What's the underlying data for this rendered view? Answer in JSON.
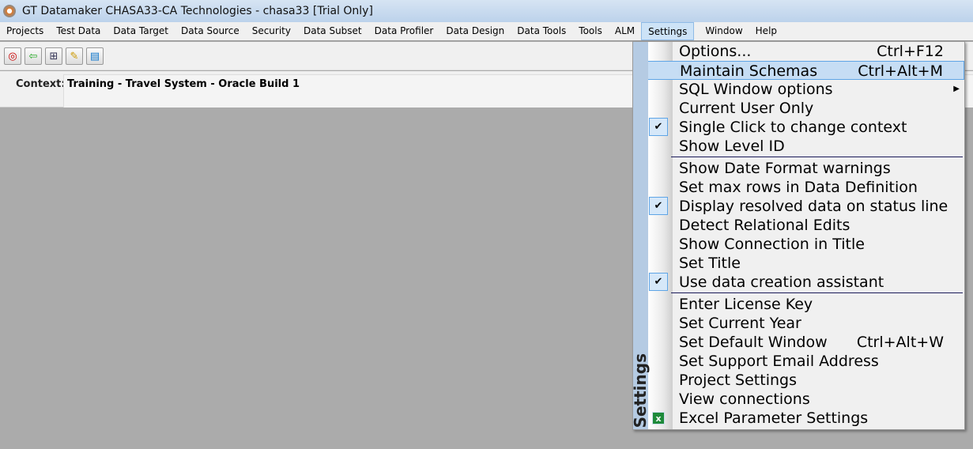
{
  "window": {
    "title": "GT Datamaker CHASA33-CA Technologies - chasa33 [Trial Only]"
  },
  "menubar": [
    "Projects",
    "Test Data",
    "Data Target",
    "Data Source",
    "Security",
    "Data Subset",
    "Data Profiler",
    "Data Design",
    "Data Tools",
    "Tools",
    "ALM",
    "Settings",
    "Window",
    "Help"
  ],
  "toolbar": {
    "icons": [
      "target-icon",
      "back-arrow-icon",
      "tree-icon",
      "notes-icon",
      "window-icon"
    ]
  },
  "context": {
    "label": "Context:",
    "value": "Training - Travel System - Oracle Build 1"
  },
  "settings_menu": {
    "side_label": "Settings",
    "groups": [
      [
        {
          "label": "Options...",
          "shortcut": "Ctrl+F12"
        },
        {
          "label": "Maintain Schemas",
          "shortcut": "Ctrl+Alt+M",
          "highlighted": true
        },
        {
          "label": "SQL Window options",
          "submenu": true
        },
        {
          "label": "Current User Only"
        },
        {
          "label": "Single Click to change context",
          "checked": true
        },
        {
          "label": "Show Level ID"
        }
      ],
      [
        {
          "label": "Show Date Format warnings"
        },
        {
          "label": "Set max rows in Data Definition"
        },
        {
          "label": "Display resolved data on status line",
          "checked": true
        },
        {
          "label": "Detect Relational Edits"
        },
        {
          "label": "Show Connection in Title"
        },
        {
          "label": "Set Title"
        },
        {
          "label": "Use data creation assistant",
          "checked": true
        }
      ],
      [
        {
          "label": "Enter License Key"
        },
        {
          "label": "Set Current Year"
        },
        {
          "label": "Set Default Window",
          "shortcut": "Ctrl+Alt+W"
        },
        {
          "label": "Set Support Email Address"
        },
        {
          "label": "Project Settings"
        },
        {
          "label": "View connections"
        },
        {
          "label": "Excel Parameter Settings",
          "icon": "excel-icon"
        }
      ]
    ]
  }
}
